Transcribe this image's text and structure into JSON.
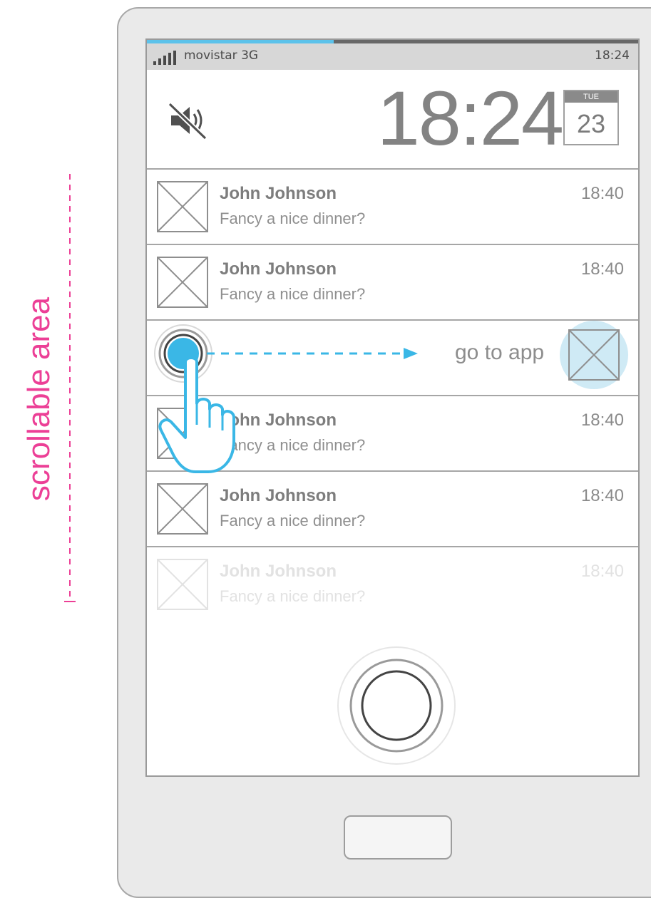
{
  "annotation": {
    "label": "scrollable area",
    "color": "#ec3f96"
  },
  "status_bar": {
    "carrier": "movistar 3G",
    "time": "18:24",
    "progress_fraction": 0.38
  },
  "lock_header": {
    "clock": "18:24",
    "calendar_day": "TUE",
    "calendar_date": "23",
    "icon": "mute-icon"
  },
  "notifications": [
    {
      "sender": "John Johnson",
      "time": "18:40",
      "message": "Fancy a nice dinner?"
    },
    {
      "sender": "John Johnson",
      "time": "18:40",
      "message": "Fancy a nice dinner?"
    },
    {
      "sender": "John Johnson",
      "time": "18:40",
      "message": "Fancy a nice dinner?"
    },
    {
      "sender": "John Johnson",
      "time": "18:40",
      "message": "Fancy a nice dinner?"
    },
    {
      "sender": "John Johnson",
      "time": "18:40",
      "message": "Fancy a nice dinner?",
      "faded": true
    }
  ],
  "swipe_row": {
    "label": "go to app",
    "accent": "#3ab7e6"
  },
  "icons": [
    "signal-icon",
    "mute-icon",
    "image-placeholder-icon",
    "hand-pointer-icon",
    "arrow-right-icon"
  ]
}
